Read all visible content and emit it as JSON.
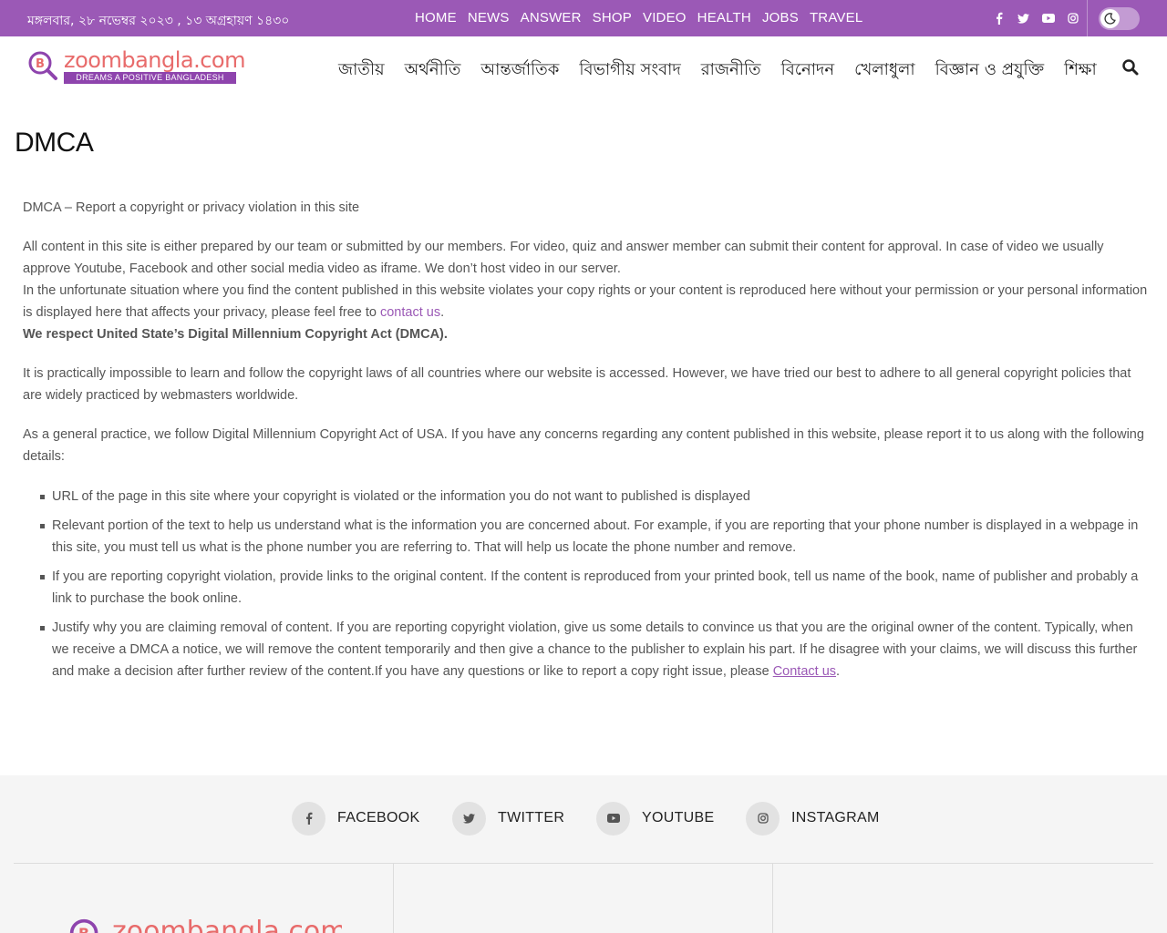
{
  "topbar": {
    "date": "মঙ্গলবার, ২৮ নভেম্বর ২০২৩ , ১৩ অগ্রহায়ণ ১৪৩০",
    "nav": [
      "HOME",
      "NEWS",
      "ANSWER",
      "SHOP",
      "VIDEO",
      "HEALTH",
      "JOBS",
      "TRAVEL"
    ],
    "social_icons": [
      "facebook-icon",
      "twitter-icon",
      "youtube-icon",
      "instagram-icon"
    ],
    "dark_mode_icon": "moon-icon",
    "bg_color": "#9b59b6"
  },
  "header": {
    "logo_name": "zoombangla.com",
    "logo_tagline": "DREAMS A POSITIVE BANGLADESH",
    "nav": [
      "জাতীয়",
      "অর্থনীতি",
      "আন্তর্জাতিক",
      "বিভাগীয় সংবাদ",
      "রাজনীতি",
      "বিনোদন",
      "খেলাধুলা",
      "বিজ্ঞান ও প্রযুক্তি",
      "শিক্ষা"
    ],
    "search_icon": "search-icon"
  },
  "page": {
    "title": "DMCA",
    "intro": "DMCA – Report a copyright or privacy violation in this site",
    "p1": "All content in this site is either prepared by our team or submitted by our members. For video, quiz and answer member can submit their content for approval.  In case of video we usually approve Youtube, Facebook and other social media video as iframe. We don’t host video in our server.",
    "p2_before": "In the unfortunate situation where you find the content published in this website violates your copy rights or your content is reproduced here without your permission or your personal information is displayed here that affects your privacy, please feel free to ",
    "p2_link": "contact us",
    "p2_after": ".",
    "p3": "We respect United State’s Digital Millennium Copyright Act (DMCA).",
    "p4": "It is practically impossible to learn and follow the copyright laws of all countries where our website is accessed. However, we have tried our best to adhere to all general copyright policies that are widely practiced by webmasters worldwide.",
    "p5": "As a general practice, we follow Digital Millennium Copyright Act of USA. If you have any concerns regarding any content published in this website, please report it to us along with the following details:",
    "list": [
      "URL of the page in this site where your copyright is violated or the information you do not want to published is displayed",
      "Relevant portion of the text to help us understand what is the information you are concerned about. For example, if you are reporting that your phone number is displayed in a webpage in this site, you must tell us what is the phone number you are referring to. That will help us locate the phone number and remove.",
      "If you are reporting copyright violation, provide links to the original content. If the content is reproduced from your printed book, tell us name of the book, name of publisher and probably a link to purchase the book online."
    ],
    "last_item_before": "Justify why you are claiming removal of content. If you are reporting copyright violation, give us some details to convince us that you are the original owner of the content. Typically, when we receive a DMCA a notice, we will remove the content temporarily and then give a chance to the publisher to explain his part. If he disagree with your claims, we will discuss this further and make a decision after further review of the content.If you have any questions or like to report a copy right issue, please ",
    "last_item_link": "Contact us",
    "last_item_after": "."
  },
  "footer": {
    "social": [
      {
        "icon": "facebook-icon",
        "label": "FACEBOOK"
      },
      {
        "icon": "twitter-icon",
        "label": "TWITTER"
      },
      {
        "icon": "youtube-icon",
        "label": "YOUTUBE"
      },
      {
        "icon": "instagram-icon",
        "label": "INSTAGRAM"
      }
    ],
    "logo_name": "zoombangla.com"
  },
  "colors": {
    "accent": "#9b59b6",
    "logo_text": "#e86b6b",
    "body_text": "#555555"
  }
}
